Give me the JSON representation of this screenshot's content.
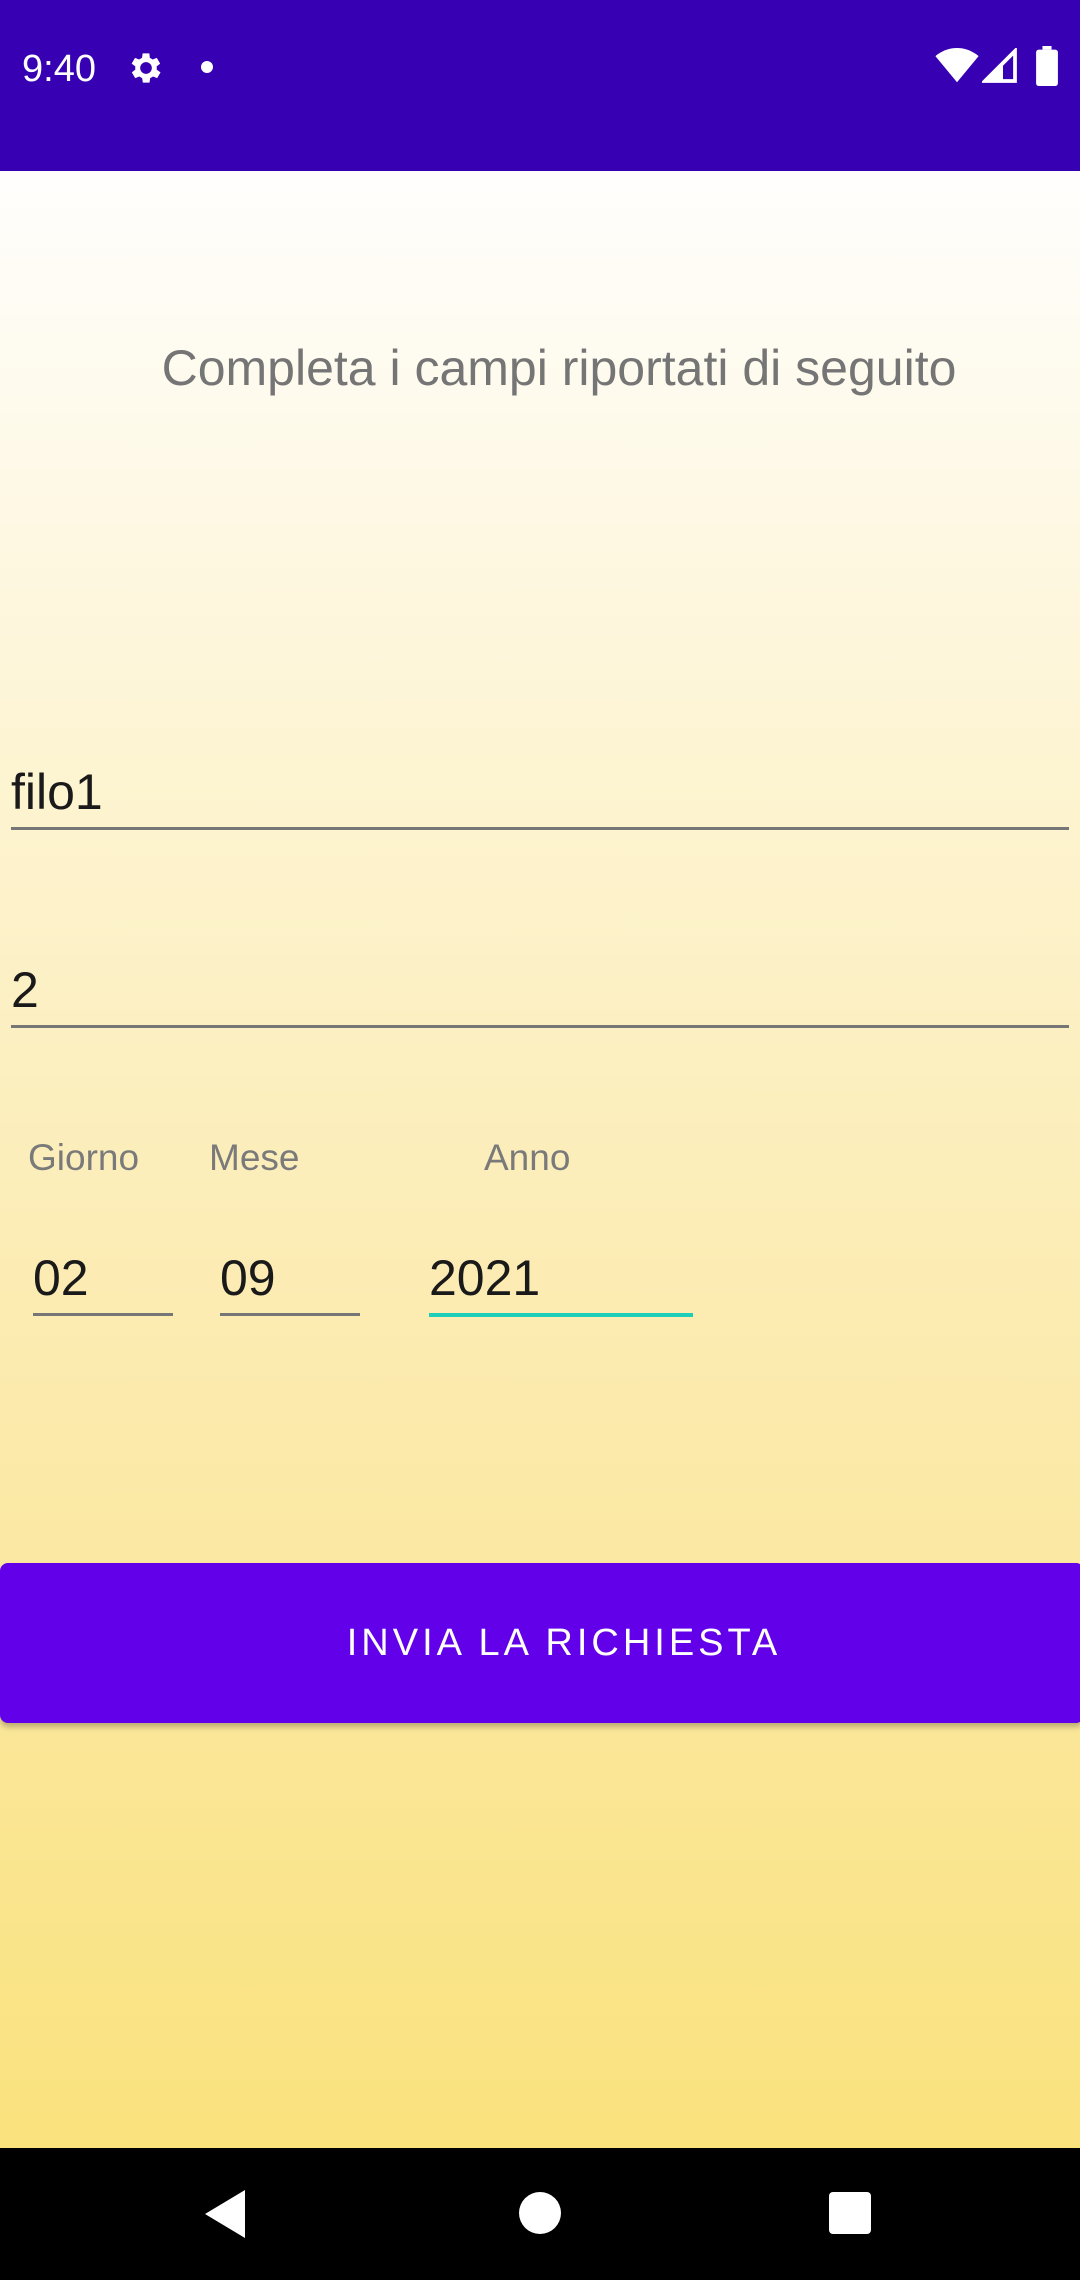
{
  "status_bar": {
    "time": "9:40",
    "icons": [
      "gear-icon",
      "notification-dot-icon",
      "wifi-icon",
      "signal-icon",
      "battery-icon"
    ],
    "background_color": "#3700b3"
  },
  "form": {
    "instruction": "Completa i campi riportati di seguito",
    "field_1_value": "filo1",
    "field_2_value": "2",
    "date": {
      "day_label": "Giorno",
      "month_label": "Mese",
      "year_label": "Anno",
      "day_value": "02",
      "month_value": "09",
      "year_value": "2021"
    },
    "submit_label": "INVIA LA RICHIESTA",
    "accent_color": "#6200ea",
    "focus_underline_color": "#1dcfb9"
  },
  "nav_bar": {
    "icons": [
      "back-icon",
      "home-icon",
      "recent-apps-icon"
    ]
  }
}
